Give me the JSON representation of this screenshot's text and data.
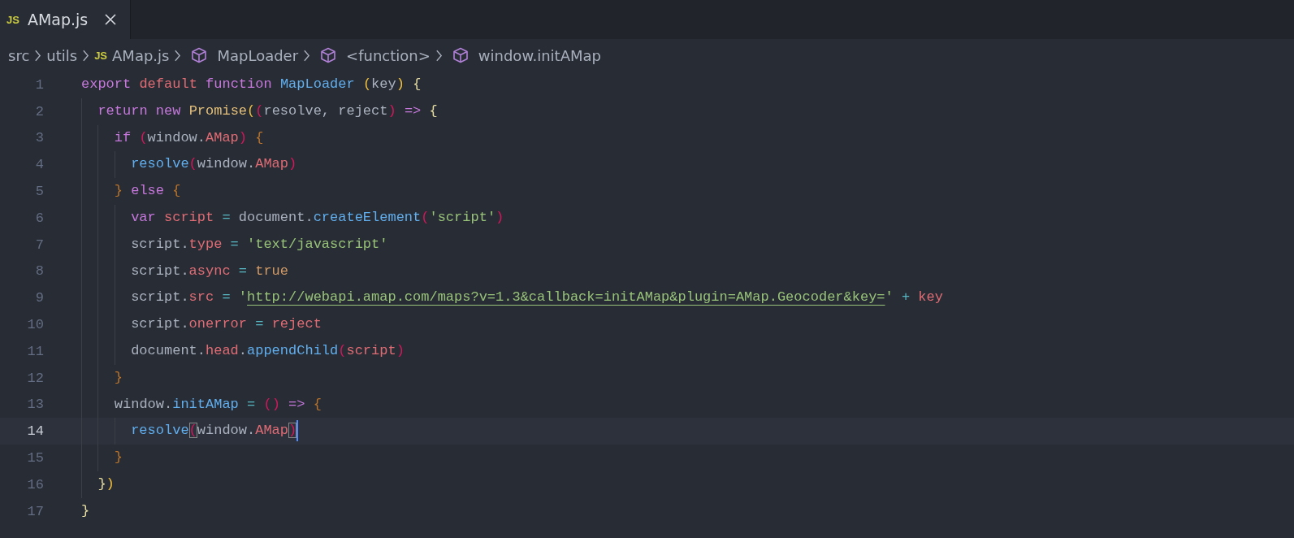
{
  "tab": {
    "icon_text": "JS",
    "label": "AMap.js",
    "selected": true
  },
  "breadcrumbs": [
    {
      "kind": "folder",
      "label": "src"
    },
    {
      "kind": "folder",
      "label": "utils"
    },
    {
      "kind": "file",
      "icon_text": "JS",
      "label": "AMap.js"
    },
    {
      "kind": "symbol",
      "label": "MapLoader"
    },
    {
      "kind": "symbol",
      "label": "<function>"
    },
    {
      "kind": "symbol",
      "label": "window.initAMap"
    }
  ],
  "lines": [
    {
      "number": "1",
      "current": false,
      "tokens": [
        {
          "kind": "kw",
          "text": "export "
        },
        {
          "kind": "kw2",
          "text": "default "
        },
        {
          "kind": "kw",
          "text": "function "
        },
        {
          "kind": "fn",
          "text": "MapLoader "
        },
        {
          "kind": "b1",
          "text": "("
        },
        {
          "kind": "plain",
          "text": "key"
        },
        {
          "kind": "b1",
          "text": ") "
        },
        {
          "kind": "b0",
          "text": "{"
        }
      ]
    },
    {
      "number": "2",
      "current": false,
      "tokens": [
        {
          "kind": "kw",
          "text": "  return "
        },
        {
          "kind": "kw",
          "text": "new "
        },
        {
          "kind": "cls",
          "text": "Promise"
        },
        {
          "kind": "b1",
          "text": "("
        },
        {
          "kind": "b2",
          "text": "("
        },
        {
          "kind": "plain",
          "text": "resolve, reject"
        },
        {
          "kind": "b2",
          "text": ") "
        },
        {
          "kind": "kw",
          "text": "=> "
        },
        {
          "kind": "b0",
          "text": "{"
        }
      ]
    },
    {
      "number": "3",
      "current": false,
      "tokens": [
        {
          "kind": "kw",
          "text": "    if "
        },
        {
          "kind": "b2",
          "text": "("
        },
        {
          "kind": "plain",
          "text": "window."
        },
        {
          "kind": "prop",
          "text": "AMap"
        },
        {
          "kind": "b2",
          "text": ") "
        },
        {
          "kind": "b3",
          "text": "{"
        }
      ]
    },
    {
      "number": "4",
      "current": false,
      "tokens": [
        {
          "kind": "fn",
          "text": "      resolve"
        },
        {
          "kind": "b2",
          "text": "("
        },
        {
          "kind": "plain",
          "text": "window."
        },
        {
          "kind": "prop",
          "text": "AMap"
        },
        {
          "kind": "b2",
          "text": ")"
        }
      ]
    },
    {
      "number": "5",
      "current": false,
      "tokens": [
        {
          "kind": "b3",
          "text": "    } "
        },
        {
          "kind": "kw",
          "text": "else "
        },
        {
          "kind": "b3",
          "text": "{"
        }
      ]
    },
    {
      "number": "6",
      "current": false,
      "tokens": [
        {
          "kind": "kw",
          "text": "      var "
        },
        {
          "kind": "prop",
          "text": "script"
        },
        {
          "kind": "op",
          "text": " = "
        },
        {
          "kind": "plain",
          "text": "document."
        },
        {
          "kind": "fn",
          "text": "createElement"
        },
        {
          "kind": "b2",
          "text": "("
        },
        {
          "kind": "str",
          "text": "'script'"
        },
        {
          "kind": "b2",
          "text": ")"
        }
      ]
    },
    {
      "number": "7",
      "current": false,
      "tokens": [
        {
          "kind": "plain",
          "text": "      script."
        },
        {
          "kind": "prop",
          "text": "type"
        },
        {
          "kind": "op",
          "text": " = "
        },
        {
          "kind": "str",
          "text": "'text/javascript'"
        }
      ]
    },
    {
      "number": "8",
      "current": false,
      "tokens": [
        {
          "kind": "plain",
          "text": "      script."
        },
        {
          "kind": "prop",
          "text": "async"
        },
        {
          "kind": "op",
          "text": " = "
        },
        {
          "kind": "num",
          "text": "true"
        }
      ]
    },
    {
      "number": "9",
      "current": false,
      "tokens": [
        {
          "kind": "plain",
          "text": "      script."
        },
        {
          "kind": "prop",
          "text": "src"
        },
        {
          "kind": "op",
          "text": " = "
        },
        {
          "kind": "str",
          "text": "'"
        },
        {
          "kind": "link",
          "text": "http://webapi.amap.com/maps?v=1.3&callback=initAMap&plugin=AMap.Geocoder&key="
        },
        {
          "kind": "str",
          "text": "'"
        },
        {
          "kind": "op",
          "text": " + "
        },
        {
          "kind": "prop",
          "text": "key"
        }
      ]
    },
    {
      "number": "10",
      "current": false,
      "tokens": [
        {
          "kind": "plain",
          "text": "      script."
        },
        {
          "kind": "prop",
          "text": "onerror"
        },
        {
          "kind": "op",
          "text": " = "
        },
        {
          "kind": "prop",
          "text": "reject"
        }
      ]
    },
    {
      "number": "11",
      "current": false,
      "tokens": [
        {
          "kind": "plain",
          "text": "      document."
        },
        {
          "kind": "prop",
          "text": "head"
        },
        {
          "kind": "plain",
          "text": "."
        },
        {
          "kind": "fn",
          "text": "appendChild"
        },
        {
          "kind": "b2",
          "text": "("
        },
        {
          "kind": "prop",
          "text": "script"
        },
        {
          "kind": "b2",
          "text": ")"
        }
      ]
    },
    {
      "number": "12",
      "current": false,
      "tokens": [
        {
          "kind": "b3",
          "text": "    }"
        }
      ]
    },
    {
      "number": "13",
      "current": false,
      "tokens": [
        {
          "kind": "plain",
          "text": "    window."
        },
        {
          "kind": "fn",
          "text": "initAMap"
        },
        {
          "kind": "op",
          "text": " = "
        },
        {
          "kind": "b2",
          "text": "() "
        },
        {
          "kind": "kw",
          "text": "=> "
        },
        {
          "kind": "b3",
          "text": "{"
        }
      ]
    },
    {
      "number": "14",
      "current": true,
      "tokens": [
        {
          "kind": "fn",
          "text": "      resolve"
        },
        {
          "kind": "matched",
          "text": "("
        },
        {
          "kind": "plain",
          "text": "window."
        },
        {
          "kind": "prop",
          "text": "AMap"
        },
        {
          "kind": "matched",
          "text": ")"
        }
      ]
    },
    {
      "number": "15",
      "current": false,
      "tokens": [
        {
          "kind": "b3",
          "text": "    }"
        }
      ]
    },
    {
      "number": "16",
      "current": false,
      "tokens": [
        {
          "kind": "b0",
          "text": "  }"
        },
        {
          "kind": "b1",
          "text": ")"
        }
      ]
    },
    {
      "number": "17",
      "current": false,
      "tokens": [
        {
          "kind": "b0",
          "text": "}"
        }
      ]
    }
  ]
}
